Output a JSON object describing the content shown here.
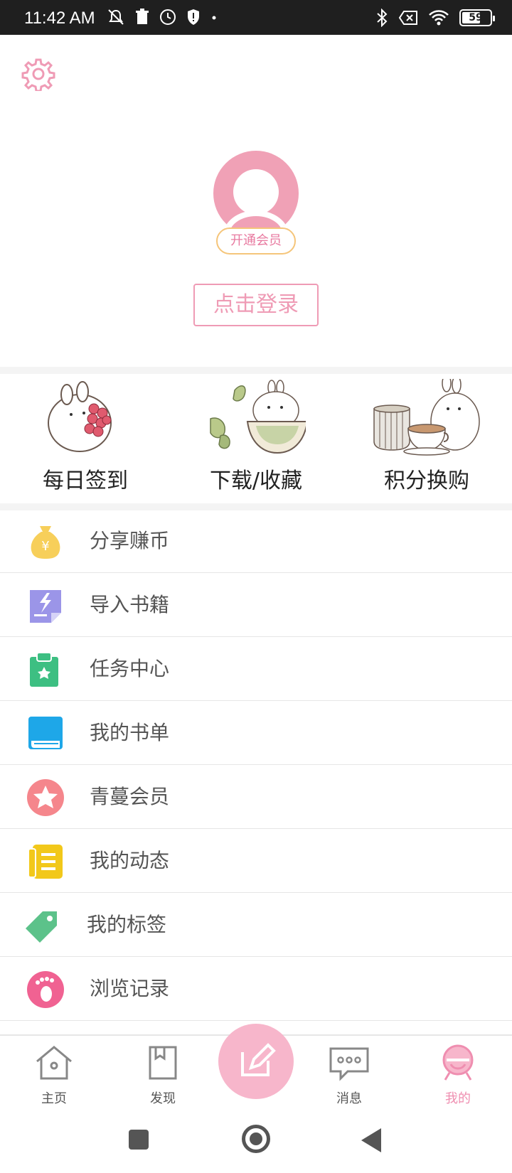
{
  "status_bar": {
    "time": "11:42 AM",
    "battery_level": "59",
    "icons_left": [
      "no-notification-icon",
      "trash-icon",
      "clock-icon",
      "shield-icon",
      "dot-icon"
    ],
    "icons_right": [
      "bluetooth-icon",
      "no-sim-icon",
      "wifi-icon",
      "battery-icon"
    ]
  },
  "header": {
    "settings_icon": "gear-icon",
    "vip_badge": "开通会员",
    "login_button": "点击登录"
  },
  "tiles": [
    {
      "label": "每日签到",
      "icon": "rabbit-with-berries-icon"
    },
    {
      "label": "下载/收藏",
      "icon": "rabbit-in-bowl-icon"
    },
    {
      "label": "积分换购",
      "icon": "rabbit-with-teacups-icon"
    }
  ],
  "menu": [
    {
      "label": "分享赚币",
      "icon": "money-bag-icon",
      "color": "#f7cf5a"
    },
    {
      "label": "导入书籍",
      "icon": "import-book-icon",
      "color": "#9b95e8"
    },
    {
      "label": "任务中心",
      "icon": "task-clipboard-icon",
      "color": "#3dbf82"
    },
    {
      "label": "我的书单",
      "icon": "booklist-icon",
      "color": "#1ea7e8"
    },
    {
      "label": "青蔓会员",
      "icon": "star-member-icon",
      "color": "#f5868c"
    },
    {
      "label": "我的动态",
      "icon": "feed-icon",
      "color": "#f2c81a"
    },
    {
      "label": "我的标签",
      "icon": "tag-icon",
      "color": "#5cc28a"
    },
    {
      "label": "浏览记录",
      "icon": "footprint-icon",
      "color": "#f06292"
    }
  ],
  "bottom_nav": [
    {
      "label": "主页",
      "icon": "home-icon",
      "active": false
    },
    {
      "label": "发现",
      "icon": "discover-icon",
      "active": false
    },
    {
      "label": "消息",
      "icon": "message-icon",
      "active": false
    },
    {
      "label": "我的",
      "icon": "profile-icon",
      "active": true
    }
  ],
  "compose_icon": "compose-icon",
  "colors": {
    "accent_pink": "#ef9bb5",
    "avatar_pink": "#f0a1b6",
    "badge_border": "#f5c57a",
    "status_bar": "#1f1f1f"
  }
}
